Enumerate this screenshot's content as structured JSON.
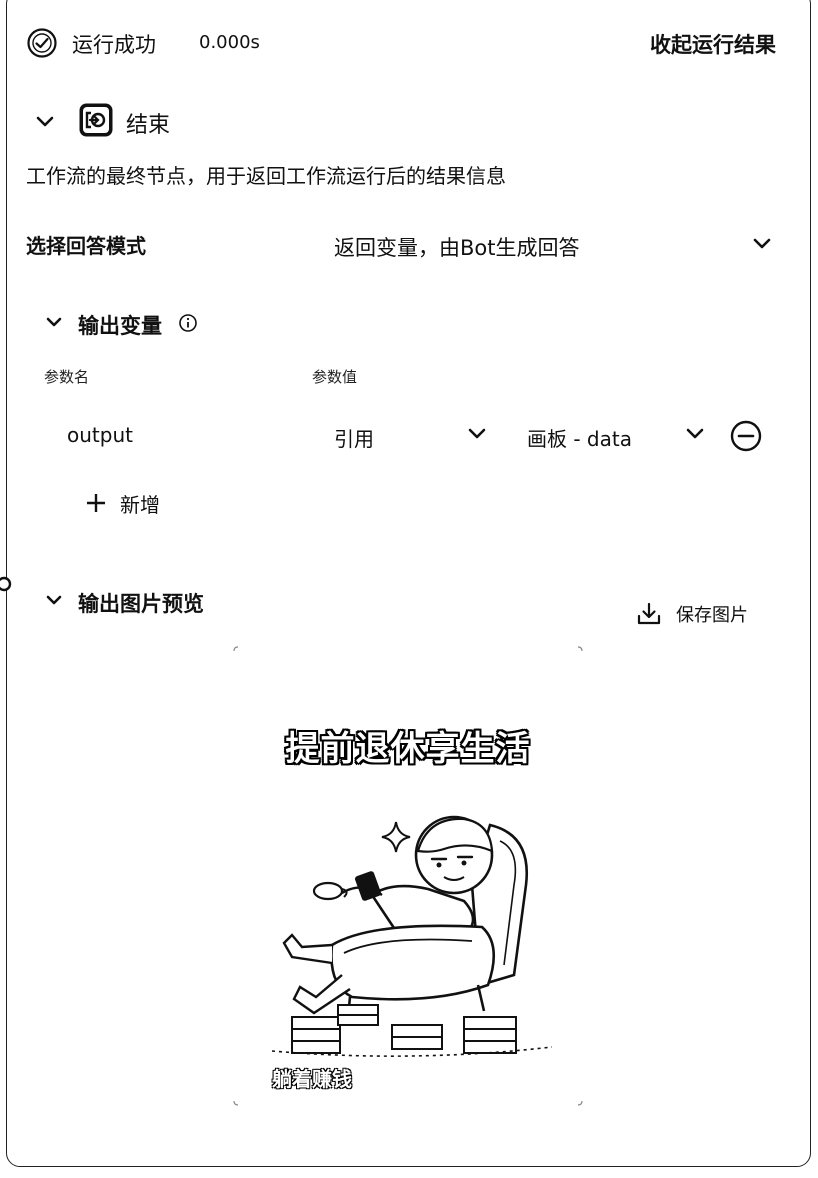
{
  "status": {
    "text": "运行成功",
    "time": "0.000s",
    "collapse_label": "收起运行结果"
  },
  "node": {
    "title": "结束",
    "icon": "end-node-icon",
    "description": "工作流的最终节点，用于返回工作流运行后的结果信息"
  },
  "answer_mode": {
    "label": "选择回答模式",
    "value": "返回变量，由Bot生成回答"
  },
  "output_vars": {
    "title": "输出变量",
    "col_name": "参数名",
    "col_value": "参数值",
    "rows": [
      {
        "name": "output",
        "ref_type": "引用",
        "ref_value": "画板 - data"
      }
    ],
    "add_label": "新增"
  },
  "preview": {
    "title": "输出图片预览",
    "save_label": "保存图片",
    "image_title": "提前退休享生活",
    "image_caption": "躺着赚钱"
  }
}
